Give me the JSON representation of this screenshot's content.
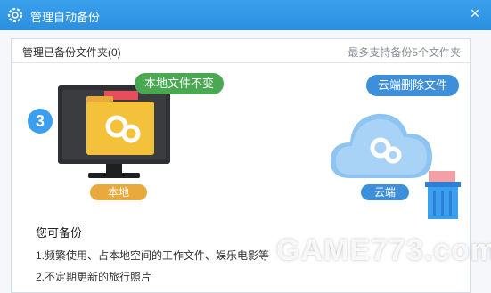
{
  "window": {
    "title": "管理自动备份",
    "close_glyph": "×"
  },
  "panel": {
    "title": "管理已备份文件夹(0)",
    "hint": "最多支持备份5个文件夹"
  },
  "illustration": {
    "step_number": "3",
    "local_bubble": "本地文件不变",
    "cloud_bubble": "云端删除文件",
    "local_label": "本地",
    "cloud_label": "云端"
  },
  "description": {
    "heading": "您可备份",
    "items": [
      "1.频繁使用、占本地空间的工作文件、娱乐电影等",
      "2.不定期更新的旅行照片"
    ]
  },
  "watermark": "GAME773.com",
  "colors": {
    "titlebar": "#2b8fdf",
    "accent_blue": "#3b9ff0",
    "bubble_green": "#4aa853",
    "local_label": "#e9a93d",
    "folder_yellow": "#f3c13a"
  },
  "icons": {
    "title": "gear-icon",
    "close": "close-icon",
    "monitor": "monitor-icon",
    "folder": "folder-icon",
    "cloud": "cloud-icon",
    "trash": "trash-icon"
  }
}
